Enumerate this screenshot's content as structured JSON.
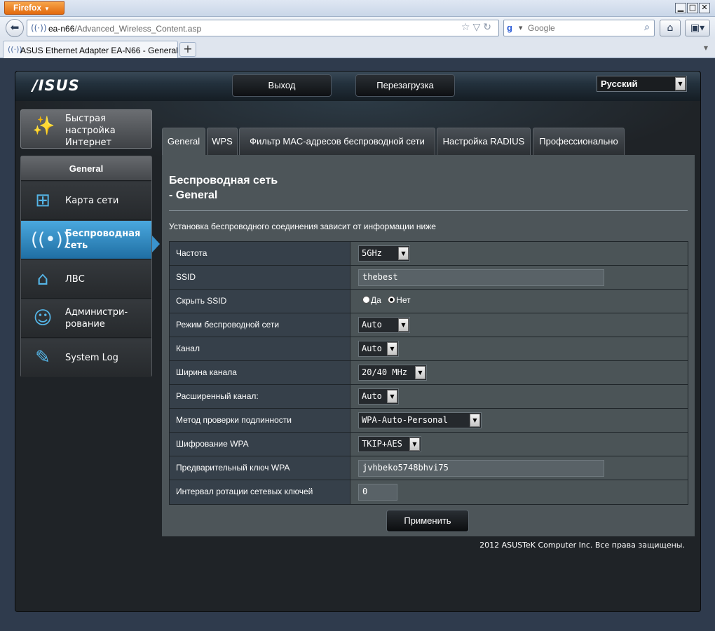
{
  "browser": {
    "menu_label": "Firefox",
    "url_host": "ea-n66",
    "url_path": "/Advanced_Wireless_Content.asp",
    "search_placeholder": "Google",
    "tab_title": "ASUS Ethernet Adapter EA-N66 - General",
    "new_tab": "+"
  },
  "header": {
    "logo": "/ISUS",
    "logout": "Выход",
    "reboot": "Перезагрузка",
    "language": "Русский"
  },
  "sidebar": {
    "quick_setup": "Быстрая настройка Интернет",
    "section": "General",
    "items": [
      {
        "label": "Карта сети",
        "icon": "network-map-icon"
      },
      {
        "label": "Беспроводная сеть",
        "icon": "wireless-icon"
      },
      {
        "label": "ЛВС",
        "icon": "lan-home-icon"
      },
      {
        "label": "Администри-рование",
        "icon": "admin-user-icon"
      },
      {
        "label": "System Log",
        "icon": "system-log-icon"
      }
    ]
  },
  "tabs": [
    "General",
    "WPS",
    "Фильтр MAC-адресов беспроводной сети",
    "Настройка RADIUS",
    "Профессионально"
  ],
  "page": {
    "title_line1": "Беспроводная сеть",
    "title_line2": "- General",
    "description": "Установка беспроводного соединения зависит от информации ниже",
    "apply": "Применить",
    "footer": "2012 ASUSTeK Computer Inc. Все права защищены."
  },
  "fields": {
    "band": {
      "label": "Частота",
      "value": "5GHz"
    },
    "ssid": {
      "label": "SSID",
      "value": "thebest"
    },
    "hide_ssid": {
      "label": "Скрыть SSID",
      "yes": "Да",
      "no": "Нет",
      "selected": "Нет"
    },
    "mode": {
      "label": "Режим беспроводной сети",
      "value": "Auto"
    },
    "channel": {
      "label": "Канал",
      "value": "Auto"
    },
    "bandwidth": {
      "label": "Ширина канала",
      "value": "20/40 MHz"
    },
    "ext_channel": {
      "label": "Расширенный канал:",
      "value": "Auto"
    },
    "auth": {
      "label": "Метод проверки подлинности",
      "value": "WPA-Auto-Personal"
    },
    "encryption": {
      "label": "Шифрование WPA",
      "value": "TKIP+AES"
    },
    "psk": {
      "label": "Предварительный ключ WPA",
      "value": "jvhbeko5748bhvi75"
    },
    "rekey": {
      "label": "Интервал ротации сетевых ключей",
      "value": "0"
    }
  }
}
